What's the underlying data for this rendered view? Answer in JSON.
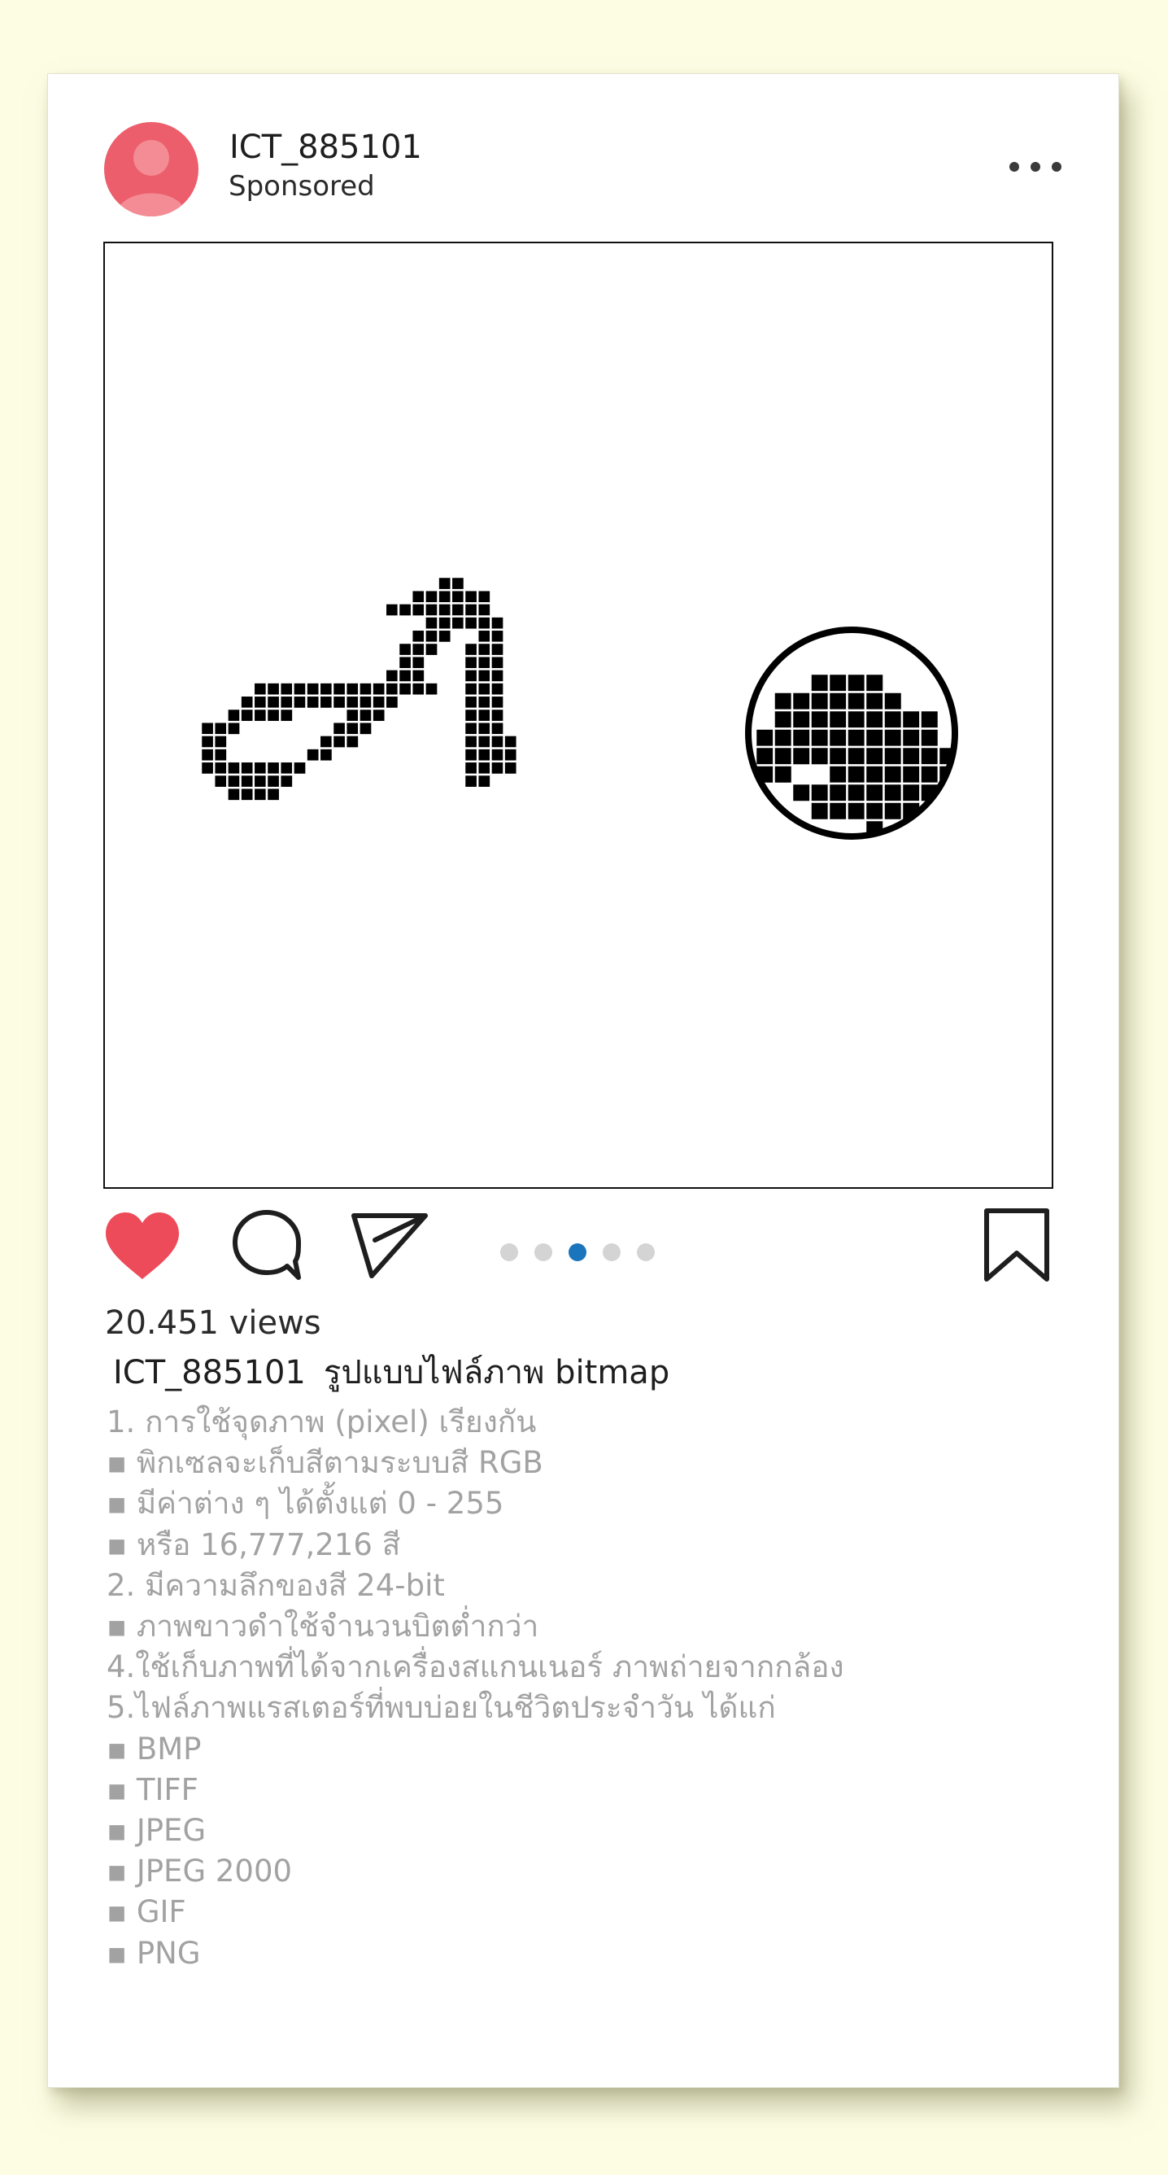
{
  "post": {
    "username": "ICT_885101",
    "sponsored": "Sponsored",
    "views": "20.451 views",
    "caption_user": "ICT_885101",
    "caption_title": "รูปแบบไฟล์ภาพ bitmap",
    "carousel": {
      "count": 5,
      "active": 3
    },
    "description": [
      "1. การใช้จุดภาพ (pixel) เรียงกัน",
      "▪ พิกเซลจะเก็บสีตามระบบสี RGB",
      "▪ มีค่าต่าง ๆ ได้ตั้งแต่ 0 - 255",
      "▪ หรือ 16,777,216 สี",
      "2. มีความลึกของสี  24-bit",
      "▪ ภาพขาวดำใช้จำนวนบิตต่ำกว่า",
      "4.ใช้เก็บภาพที่ได้จากเครื่องสแกนเนอร์ ภาพถ่ายจากกล้อง",
      "5.ไฟล์ภาพแรสเตอร์ที่พบบ่อยในชีวิตประจำวัน ได้แก่",
      "▪  BMP",
      "▪ TIFF",
      "▪ JPEG",
      "▪ JPEG 2000",
      "▪ GIF",
      "▪ PNG"
    ]
  },
  "icons": {
    "avatar": "user-avatar-icon",
    "more": "more-options-icon",
    "like": "heart-icon",
    "comment": "comment-bubble-icon",
    "share": "paper-plane-icon",
    "save": "bookmark-icon"
  },
  "colors": {
    "background": "#fdfde4",
    "avatar": "#ec5e6c",
    "heart": "#ee4b5a",
    "dot_active": "#1b75bc",
    "dot_inactive": "#d4d4d4",
    "caption_grey": "#a2a2a2"
  }
}
